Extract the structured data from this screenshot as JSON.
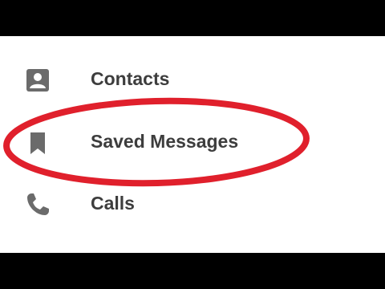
{
  "menu": {
    "items": [
      {
        "label": "Contacts",
        "icon": "contact-person-icon"
      },
      {
        "label": "Saved Messages",
        "icon": "bookmark-icon"
      },
      {
        "label": "Calls",
        "icon": "phone-icon"
      }
    ]
  },
  "colors": {
    "letterbox": "#000000",
    "panel": "#ffffff",
    "icon": "#6b6b6b",
    "text": "#3d3d3d",
    "highlight_ring": "#e0202c"
  }
}
